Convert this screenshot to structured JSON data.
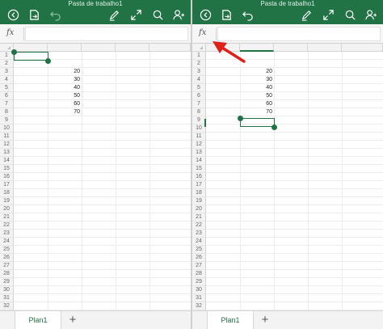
{
  "workbook_title": "Pasta de trabalho1",
  "toolbar": {
    "icons": [
      "back-icon",
      "save-icon",
      "undo-icon",
      "pen-icon",
      "expand-icon",
      "search-icon",
      "share-person-icon"
    ]
  },
  "formula_bar": {
    "fx_label": "fx",
    "value": ""
  },
  "row_numbers": [
    "1",
    "2",
    "3",
    "4",
    "5",
    "6",
    "7",
    "8",
    "9",
    "10",
    "11",
    "12",
    "13",
    "14",
    "15",
    "16",
    "17",
    "18",
    "19",
    "20",
    "21",
    "22",
    "23",
    "24",
    "25",
    "26",
    "27",
    "28",
    "29",
    "30",
    "31",
    "32"
  ],
  "cell_values": [
    "20",
    "30",
    "40",
    "50",
    "60",
    "70"
  ],
  "sheet": {
    "tab_label": "Plan1",
    "add_label": "+"
  },
  "colors": {
    "excel_green": "#217346",
    "arrow_red": "#e0201b"
  }
}
